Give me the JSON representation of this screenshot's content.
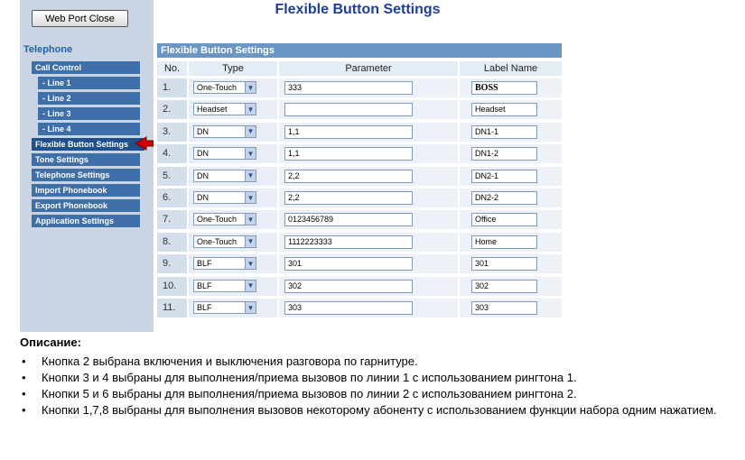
{
  "sidebar": {
    "port_button": "Web Port Close",
    "section_title": "Telephone",
    "items": [
      {
        "label": "Call Control",
        "sub": false,
        "active": false
      },
      {
        "label": "- Line 1",
        "sub": true,
        "active": false
      },
      {
        "label": "- Line 2",
        "sub": true,
        "active": false
      },
      {
        "label": "- Line 3",
        "sub": true,
        "active": false
      },
      {
        "label": "- Line 4",
        "sub": true,
        "active": false
      },
      {
        "label": "Flexible Button Settings",
        "sub": false,
        "active": true
      },
      {
        "label": "Tone Settings",
        "sub": false,
        "active": false
      },
      {
        "label": "Telephone Settings",
        "sub": false,
        "active": false
      },
      {
        "label": "Import Phonebook",
        "sub": false,
        "active": false
      },
      {
        "label": "Export Phonebook",
        "sub": false,
        "active": false
      },
      {
        "label": "Application Settings",
        "sub": false,
        "active": false
      }
    ],
    "arrow_color": "#cc0000"
  },
  "main": {
    "page_title": "Flexible Button Settings",
    "table_title": "Flexible Button Settings",
    "columns": [
      "No.",
      "Type",
      "Parameter",
      "Label Name"
    ],
    "rows": [
      {
        "no": "1.",
        "type": "One-Touch",
        "parameter": "333",
        "label": "BOSS"
      },
      {
        "no": "2.",
        "type": "Headset",
        "parameter": "",
        "label": "Headset"
      },
      {
        "no": "3.",
        "type": "DN",
        "parameter": "1,1",
        "label": "DN1-1"
      },
      {
        "no": "4.",
        "type": "DN",
        "parameter": "1,1",
        "label": "DN1-2"
      },
      {
        "no": "5.",
        "type": "DN",
        "parameter": "2,2",
        "label": "DN2-1"
      },
      {
        "no": "6.",
        "type": "DN",
        "parameter": "2,2",
        "label": "DN2-2"
      },
      {
        "no": "7.",
        "type": "One-Touch",
        "parameter": "0123456789",
        "label": "Office"
      },
      {
        "no": "8.",
        "type": "One-Touch",
        "parameter": "1112223333",
        "label": "Home"
      },
      {
        "no": "9.",
        "type": "BLF",
        "parameter": "301",
        "label": "301"
      },
      {
        "no": "10.",
        "type": "BLF",
        "parameter": "302",
        "label": "302"
      },
      {
        "no": "11.",
        "type": "BLF",
        "parameter": "303",
        "label": "303"
      }
    ]
  },
  "description": {
    "title": "Описание:",
    "bullets": [
      "Кнопка 2 выбрана включения и выключения разговора по гарнитуре.",
      "Кнопки 3 и 4 выбраны для выполнения/приема вызовов по линии 1 с использованием рингтона 1.",
      "Кнопки 5 и 6 выбраны для выполнения/приема вызовов по линии 2 с использованием рингтона 2.",
      "Кнопки 1,7,8 выбраны для выполнения вызовов некоторому абоненту с использованием функции набора одним нажатием."
    ]
  }
}
